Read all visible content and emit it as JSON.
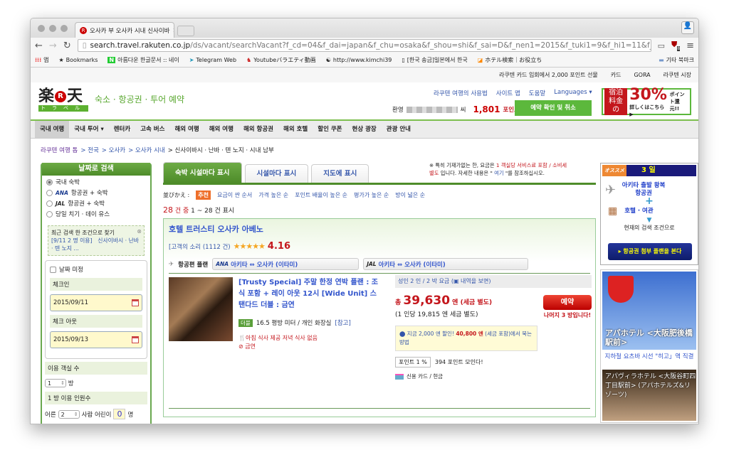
{
  "browser": {
    "tab_title": "오사카 부 오사카 시내 신사이바",
    "url_host": "search.travel.rakuten.co.jp",
    "url_path": "/ds/vacant/searchVacant?f_cd=04&f_dai=japan&f_chu=osaka&f_shou=shi&f_sai=D&f_nen1=2015&f_tuki1=9&f_hi1=11&f_nen2=...",
    "ext_badge": "8",
    "bookmarks": [
      "앱",
      "Bookmarks",
      "아름다운 한글문서 :: 네이",
      "Telegram Web",
      "Youtubeバラエティ動画",
      "http://www.kimchi39",
      "[한국 송금]일본에서 한국",
      "ホテル検索｜お役立ち"
    ],
    "other_bookmarks": "기타 북마크"
  },
  "topbar": [
    "라쿠텐 카드 입회에서 2,000 포인트 선물",
    "카드",
    "GORA",
    "라쿠텐 시장"
  ],
  "header": {
    "logo_kanji": "楽天",
    "logo_kana": "トラベル",
    "tagline": "숙소 · 항공권 · 투어 예약",
    "links": [
      "라쿠텐 여행의 사용법",
      "사이트 맵",
      "도움말",
      "Languages ▾"
    ],
    "greeting": "환영",
    "suffix": "씨",
    "points": "1,801",
    "points_label": "포인트",
    "reserve_btn": "예약 확인 및 취소",
    "ad": {
      "a": "宿泊",
      "b": "料金の",
      "pct": "30%",
      "c": "ポイント還元!!",
      "d": "詳しくはこちら ▶"
    }
  },
  "nav": [
    "국내 여행",
    "국내 투어 ▾",
    "렌터카",
    "고속 버스",
    "해외 여행",
    "해외 여행",
    "해외 항공권",
    "해외 호텔",
    "할인 쿠폰",
    "현상 광장",
    "관광 안내"
  ],
  "breadcrumb": [
    "라쿠텐 여행 톱",
    "> 전국",
    "> 오사카",
    "> 오사카 시내",
    "> 신사이바시 · 난바 · 텐 노지 · 시내 남부"
  ],
  "sidebar": {
    "title": "날짜로 검색",
    "options": [
      "국내 숙박",
      "항공권 + 숙박",
      "항공권 + 숙박",
      "당일 치기 · 데이 유스"
    ],
    "ana": "ANA",
    "jal": "JAL",
    "recent_title": "최근 검색 한 조건으로 찾기",
    "recent_link": "[9/11 2 명 이용]　신사이바시 · 난바 · 텐 노지 ...",
    "undecided": "날짜 미정",
    "checkin_label": "체크인",
    "checkin": "2015/09/11",
    "checkout_label": "체크 아웃",
    "checkout": "2015/09/13",
    "rooms_label": "이용 객실 수",
    "rooms": "1",
    "rooms_unit": "방",
    "guests_label": "1 방 이용 인원수",
    "adult_label": "어른",
    "adults": "2",
    "child_label": "사람 어린이",
    "children": "0",
    "child_unit": "명"
  },
  "main": {
    "tabs": [
      "숙박 시설마다 표시",
      "시설마다 표시",
      "지도에 표시"
    ],
    "note": {
      "a": "※ 특히 기재가없는 한, 요금은 ",
      "b": "1 객실당 서비스료 포함 / 소비세 별도",
      "c": " 입니다. 자세한 내용은 \" ",
      "d": "여기",
      "e": " \"를 참조하십시오."
    },
    "sort_label": "並びかえ :",
    "sort": [
      "추천",
      "요금이 싼 순서",
      "가격 높은 순",
      "포인트 배율이 높은 순",
      "평가가 높은 순",
      "방이 넓은 순"
    ],
    "count_total": "28",
    "count_a": "건 중",
    "count_b": "1 ~ 28 건 표시",
    "hotel": {
      "name": "호텔 트러스티 오사카 아베노",
      "reviews": "[고객의 소리 (1112 건)",
      "stars": "★★★★★",
      "rating": "4.16",
      "air_label": "항공편 플랜",
      "ana_route": "아키타 ⇔ 오사카 (이타미)",
      "jal_route": "아키타 ⇔ 오사카 (이타미)",
      "plan_title": "[Trusty Special] 주말 한정 연박 플랜 : 조식 포함 + 레이 아웃 12시 [Wide Unit] 스탠다드 더블 : 금연",
      "room_tag": "더블",
      "room_desc": "16.5 평방 미터 / 개인 화장실",
      "room_ref": "[참고]",
      "meal": "아침 식사 제공 저녁 식사 없음",
      "smoking": "금연",
      "price_head": "성인 2 인 / 2 박 요금 (▣ 내역을 보면)",
      "total_prefix": "총",
      "total": "39,630",
      "total_suffix": "엔 (세금 별도)",
      "per_person": "(1 인당 19,815 엔 세금 별도)",
      "discount": "지금 2,000 엔 할인!",
      "discount_price": "40,800 엔",
      "discount_rest": "(세금 포함)에서 묵는 방법",
      "book": "예약",
      "rooms_left": "나머지 3 방입니다!",
      "point_rate": "포인트 1 %",
      "points_earn": "394 포인트 모인다!",
      "payment": "신용 카드 / 현금"
    }
  },
  "right": {
    "badge": "オススメ",
    "days": "3 일",
    "line1": "아키타 출발 왕복 항공권",
    "plus": "+",
    "line2": "호텔 · 여관",
    "current": "현재의 검색 조건으로",
    "btn": "▸ 항공권 첨부 플랜을 본다",
    "hotel1": "アパホテル <大阪肥後橋駅前>",
    "hotel1_link": "지하철 요츠바 시선 \"히고」역 직결",
    "hotel2": "アパヴィラホテル <大阪谷町四丁目駅前> (アパホテルズ&リゾーツ)"
  }
}
